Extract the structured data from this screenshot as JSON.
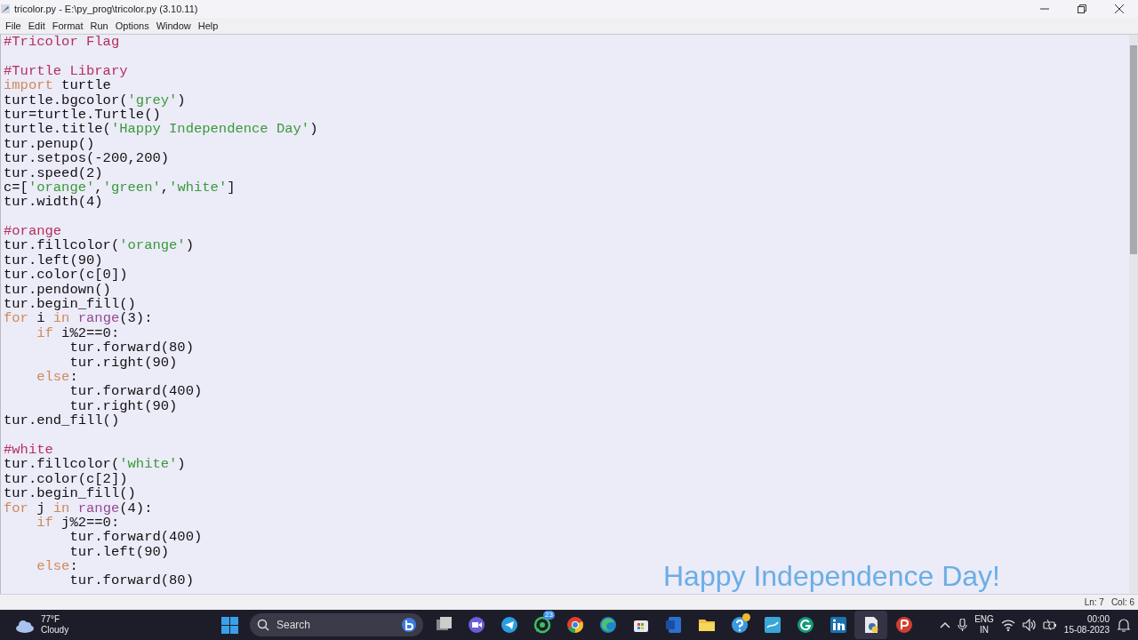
{
  "window": {
    "title": "tricolor.py - E:\\py_prog\\tricolor.py (3.10.11)"
  },
  "menu": [
    "File",
    "Edit",
    "Format",
    "Run",
    "Options",
    "Window",
    "Help"
  ],
  "editor": {
    "lines": [
      {
        "kind": "code",
        "tokens": [
          {
            "kind": "comment",
            "text": "#Tricolor Flag"
          }
        ]
      },
      {
        "kind": "blank"
      },
      {
        "kind": "code",
        "tokens": [
          {
            "kind": "comment",
            "text": "#Turtle Library"
          }
        ]
      },
      {
        "kind": "code",
        "tokens": [
          {
            "kind": "keyword",
            "text": "import"
          },
          {
            "kind": "plain",
            "text": " turtle"
          }
        ]
      },
      {
        "kind": "code",
        "tokens": [
          {
            "kind": "plain",
            "text": "turtle.bgcolor("
          },
          {
            "kind": "string",
            "text": "'grey'"
          },
          {
            "kind": "plain",
            "text": ")"
          }
        ]
      },
      {
        "kind": "code",
        "tokens": [
          {
            "kind": "plain",
            "text": "tur=turtle.Turtle()"
          }
        ]
      },
      {
        "kind": "code",
        "tokens": [
          {
            "kind": "plain",
            "text": "turtle.title("
          },
          {
            "kind": "string",
            "text": "'Happy Independence Day'"
          },
          {
            "kind": "plain",
            "text": ")"
          }
        ]
      },
      {
        "kind": "code",
        "tokens": [
          {
            "kind": "plain",
            "text": "tur.penup()"
          }
        ]
      },
      {
        "kind": "code",
        "tokens": [
          {
            "kind": "plain",
            "text": "tur.setpos(-200,200)"
          }
        ]
      },
      {
        "kind": "code",
        "tokens": [
          {
            "kind": "plain",
            "text": "tur.speed(2)"
          }
        ]
      },
      {
        "kind": "code",
        "tokens": [
          {
            "kind": "plain",
            "text": "c=["
          },
          {
            "kind": "string",
            "text": "'orange'"
          },
          {
            "kind": "plain",
            "text": ","
          },
          {
            "kind": "string",
            "text": "'green'"
          },
          {
            "kind": "plain",
            "text": ","
          },
          {
            "kind": "string",
            "text": "'white'"
          },
          {
            "kind": "plain",
            "text": "]"
          }
        ]
      },
      {
        "kind": "code",
        "tokens": [
          {
            "kind": "plain",
            "text": "tur.width(4)"
          }
        ]
      },
      {
        "kind": "blank"
      },
      {
        "kind": "code",
        "tokens": [
          {
            "kind": "comment",
            "text": "#orange"
          }
        ]
      },
      {
        "kind": "code",
        "tokens": [
          {
            "kind": "plain",
            "text": "tur.fillcolor("
          },
          {
            "kind": "string",
            "text": "'orange'"
          },
          {
            "kind": "plain",
            "text": ")"
          }
        ]
      },
      {
        "kind": "code",
        "tokens": [
          {
            "kind": "plain",
            "text": "tur.left(90)"
          }
        ]
      },
      {
        "kind": "code",
        "tokens": [
          {
            "kind": "plain",
            "text": "tur.color(c[0])"
          }
        ]
      },
      {
        "kind": "code",
        "tokens": [
          {
            "kind": "plain",
            "text": "tur.pendown()"
          }
        ]
      },
      {
        "kind": "code",
        "tokens": [
          {
            "kind": "plain",
            "text": "tur.begin_fill()"
          }
        ]
      },
      {
        "kind": "code",
        "tokens": [
          {
            "kind": "keyword",
            "text": "for"
          },
          {
            "kind": "plain",
            "text": " i "
          },
          {
            "kind": "keyword",
            "text": "in"
          },
          {
            "kind": "builtin",
            "text": " range"
          },
          {
            "kind": "plain",
            "text": "(3):"
          }
        ]
      },
      {
        "kind": "code",
        "tokens": [
          {
            "kind": "keyword",
            "text": "    if"
          },
          {
            "kind": "plain",
            "text": " i%2==0:"
          }
        ]
      },
      {
        "kind": "code",
        "tokens": [
          {
            "kind": "plain",
            "text": "        tur.forward(80)"
          }
        ]
      },
      {
        "kind": "code",
        "tokens": [
          {
            "kind": "plain",
            "text": "        tur.right(90)"
          }
        ]
      },
      {
        "kind": "code",
        "tokens": [
          {
            "kind": "keyword",
            "text": "    else"
          },
          {
            "kind": "plain",
            "text": ":"
          }
        ]
      },
      {
        "kind": "code",
        "tokens": [
          {
            "kind": "plain",
            "text": "        tur.forward(400)"
          }
        ]
      },
      {
        "kind": "code",
        "tokens": [
          {
            "kind": "plain",
            "text": "        tur.right(90)"
          }
        ]
      },
      {
        "kind": "code",
        "tokens": [
          {
            "kind": "plain",
            "text": "tur.end_fill()"
          }
        ]
      },
      {
        "kind": "blank"
      },
      {
        "kind": "code",
        "tokens": [
          {
            "kind": "comment",
            "text": "#white"
          }
        ]
      },
      {
        "kind": "code",
        "tokens": [
          {
            "kind": "plain",
            "text": "tur.fillcolor("
          },
          {
            "kind": "string",
            "text": "'white'"
          },
          {
            "kind": "plain",
            "text": ")"
          }
        ]
      },
      {
        "kind": "code",
        "tokens": [
          {
            "kind": "plain",
            "text": "tur.color(c[2])"
          }
        ]
      },
      {
        "kind": "code",
        "tokens": [
          {
            "kind": "plain",
            "text": "tur.begin_fill()"
          }
        ]
      },
      {
        "kind": "code",
        "tokens": [
          {
            "kind": "keyword",
            "text": "for"
          },
          {
            "kind": "plain",
            "text": " j "
          },
          {
            "kind": "keyword",
            "text": "in"
          },
          {
            "kind": "builtin",
            "text": " range"
          },
          {
            "kind": "plain",
            "text": "(4):"
          }
        ]
      },
      {
        "kind": "code",
        "tokens": [
          {
            "kind": "keyword",
            "text": "    if"
          },
          {
            "kind": "plain",
            "text": " j%2==0:"
          }
        ]
      },
      {
        "kind": "code",
        "tokens": [
          {
            "kind": "plain",
            "text": "        tur.forward(400)"
          }
        ]
      },
      {
        "kind": "code",
        "tokens": [
          {
            "kind": "plain",
            "text": "        tur.left(90)"
          }
        ]
      },
      {
        "kind": "code",
        "tokens": [
          {
            "kind": "keyword",
            "text": "    else"
          },
          {
            "kind": "plain",
            "text": ":"
          }
        ]
      },
      {
        "kind": "code",
        "tokens": [
          {
            "kind": "plain",
            "text": "        tur.forward(80)"
          }
        ]
      }
    ]
  },
  "turtle_window": {
    "text": "Happy Independence Day!"
  },
  "status_bar": {
    "line": "Ln: 7",
    "column": "Col: 6"
  },
  "taskbar": {
    "weather": {
      "temperature": "77°F",
      "condition": "Cloudy"
    },
    "search": {
      "placeholder": "Search"
    },
    "apps": [
      {
        "kind": "taskview",
        "selected": false
      },
      {
        "kind": "meet",
        "selected": false
      },
      {
        "kind": "telegram",
        "selected": false
      },
      {
        "kind": "whatsapp",
        "selected": false,
        "badge": "23"
      },
      {
        "kind": "chrome",
        "selected": false
      },
      {
        "kind": "edge",
        "selected": false
      },
      {
        "kind": "store",
        "selected": false
      },
      {
        "kind": "word",
        "selected": false
      },
      {
        "kind": "files",
        "selected": false
      },
      {
        "kind": "help",
        "selected": false,
        "alert": true
      },
      {
        "kind": "tile",
        "selected": false
      },
      {
        "kind": "grammarly",
        "selected": false
      },
      {
        "kind": "linkedin",
        "selected": false
      },
      {
        "kind": "python",
        "selected": true
      },
      {
        "kind": "powerpoint",
        "selected": false
      }
    ],
    "language": [
      "ENG",
      "IN"
    ],
    "time": "00:00",
    "date": "15-08-2023"
  }
}
